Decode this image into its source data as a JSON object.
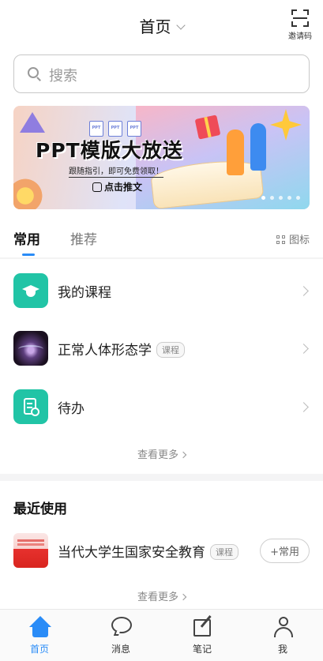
{
  "header": {
    "title": "首页",
    "invite_label": "邀请码"
  },
  "search": {
    "placeholder": "搜索"
  },
  "banner": {
    "headline": "PPT模版大放送",
    "subtext": "跟随指引，即可免费领取！",
    "cta": "点击推文",
    "doc_label": "PPT",
    "slides": 5,
    "active_slide": 1
  },
  "tabs": {
    "items": [
      {
        "label": "常用",
        "active": true
      },
      {
        "label": "推荐",
        "active": false
      }
    ],
    "view_toggle": "图标"
  },
  "common": {
    "items": [
      {
        "label": "我的课程",
        "badge": "",
        "icon": "graduation-cap-icon"
      },
      {
        "label": "正常人体形态学",
        "badge": "课程",
        "icon": "course-thumbnail"
      },
      {
        "label": "待办",
        "badge": "",
        "icon": "todo-icon"
      }
    ],
    "more": "查看更多"
  },
  "recent": {
    "title": "最近使用",
    "items": [
      {
        "label": "当代大学生国家安全教育",
        "badge": "课程",
        "action": "+常用"
      }
    ],
    "more": "查看更多"
  },
  "nav": {
    "items": [
      {
        "label": "首页",
        "active": true
      },
      {
        "label": "消息"
      },
      {
        "label": "笔记"
      },
      {
        "label": "我"
      }
    ]
  },
  "colors": {
    "accent": "#2a8cf7",
    "teal": "#21c4a6"
  }
}
